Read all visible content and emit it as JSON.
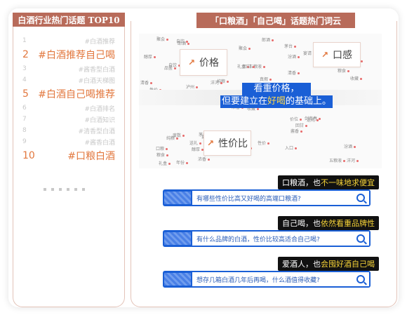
{
  "left": {
    "title": "白酒行业热门话题 TOP10",
    "topics": [
      {
        "rank": "1",
        "text": "#白酒推荐"
      },
      {
        "rank": "2",
        "text": "#白酒推荐自己喝"
      },
      {
        "rank": "3",
        "text": "#酱香型白酒"
      },
      {
        "rank": "4",
        "text": "#白酒天梯图"
      },
      {
        "rank": "5",
        "text": "#白酒自己喝推荐"
      },
      {
        "rank": "6",
        "text": "#白酒排名"
      },
      {
        "rank": "7",
        "text": "#白酒知识"
      },
      {
        "rank": "8",
        "text": "#清香型白酒"
      },
      {
        "rank": "9",
        "text": "#酱香白酒"
      },
      {
        "rank": "10",
        "text": "#口粮白酒"
      }
    ]
  },
  "right": {
    "title": "「口粮酒」「自己喝」话题热门词云",
    "keywords": [
      "价格",
      "口感",
      "性价比"
    ],
    "banner_line1": "看重价格，",
    "banner_line2_pre": "但要建立在",
    "banner_line2_hl": "好喝",
    "banner_line2_post": "的基础上。",
    "cloud_words": [
      "收藏",
      "品鉴",
      "推荐",
      "口粮",
      "商务",
      "宴请",
      "茅台",
      "五粮液",
      "汾酒",
      "剑南春",
      "郎酒",
      "洋河",
      "泸州",
      "酱香",
      "浓香",
      "清香",
      "年份",
      "礼盒",
      "真假",
      "度数",
      "纯粮",
      "粮食",
      "醇厚",
      "回甘",
      "入口",
      "送礼",
      "自饮",
      "聚会",
      "性价",
      "价位"
    ],
    "qa": [
      {
        "tag_pre": "口粮酒，也",
        "tag_hl": "不一味地求便宜",
        "tag_post": "",
        "query": "有哪些性价比高又好喝的高端口粮酒?"
      },
      {
        "tag_pre": "自己喝，也",
        "tag_hl": "依然看重品牌性",
        "tag_post": "",
        "query": "有什么品牌的白酒，性价比较高适合自己喝?"
      },
      {
        "tag_pre": "爱酒人，也",
        "tag_hl": "会囤好酒自己喝",
        "tag_post": "",
        "query": "想存几箱白酒几年后再喝，什么酒值得收藏?"
      }
    ]
  }
}
